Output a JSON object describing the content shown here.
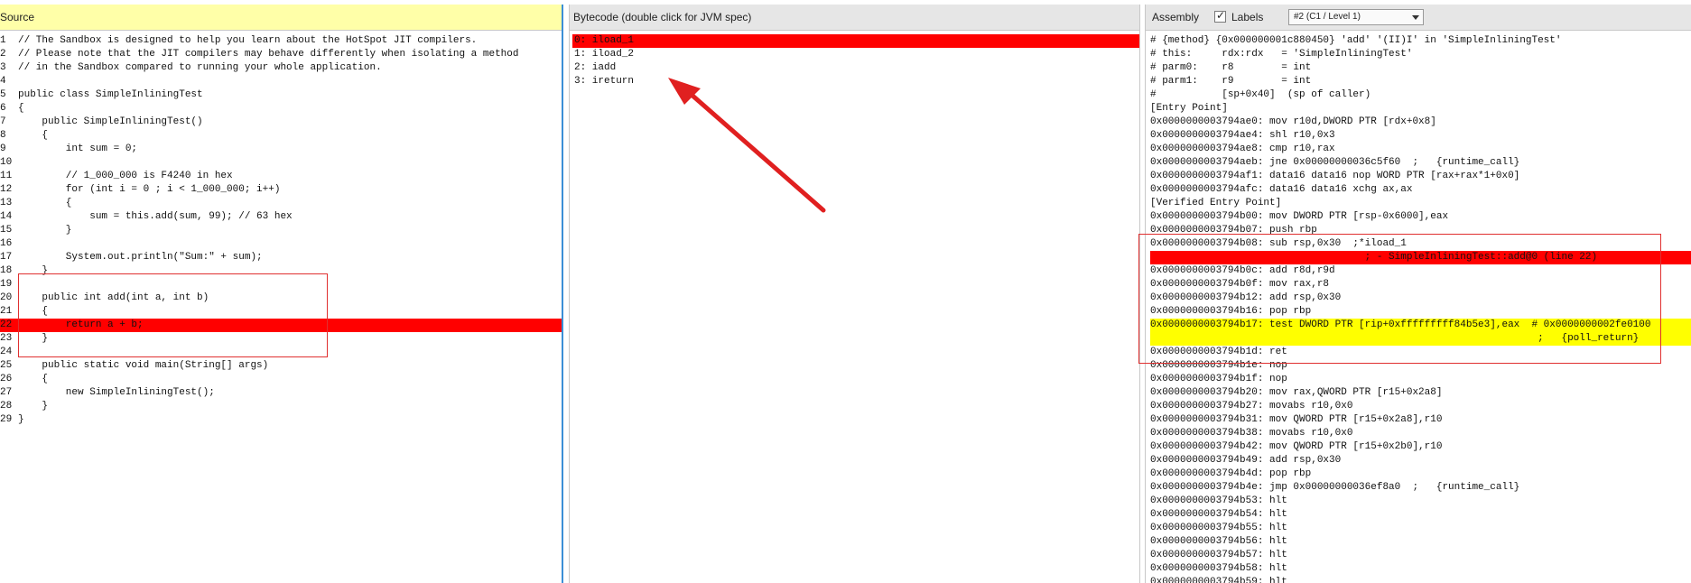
{
  "source": {
    "title": "Source",
    "lines": [
      {
        "n": "1",
        "text": "// The Sandbox is designed to help you learn about the HotSpot JIT compilers."
      },
      {
        "n": "2",
        "text": "// Please note that the JIT compilers may behave differently when isolating a method"
      },
      {
        "n": "3",
        "text": "// in the Sandbox compared to running your whole application."
      },
      {
        "n": "4",
        "text": ""
      },
      {
        "n": "5",
        "text": "public class SimpleInliningTest"
      },
      {
        "n": "6",
        "text": "{"
      },
      {
        "n": "7",
        "text": "    public SimpleInliningTest()"
      },
      {
        "n": "8",
        "text": "    {"
      },
      {
        "n": "9",
        "text": "        int sum = 0;"
      },
      {
        "n": "10",
        "text": ""
      },
      {
        "n": "11",
        "text": "        // 1_000_000 is F4240 in hex"
      },
      {
        "n": "12",
        "text": "        for (int i = 0 ; i < 1_000_000; i++)"
      },
      {
        "n": "13",
        "text": "        {"
      },
      {
        "n": "14",
        "text": "            sum = this.add(sum, 99); // 63 hex"
      },
      {
        "n": "15",
        "text": "        }"
      },
      {
        "n": "16",
        "text": ""
      },
      {
        "n": "17",
        "text": "        System.out.println(\"Sum:\" + sum);"
      },
      {
        "n": "18",
        "text": "    }"
      },
      {
        "n": "19",
        "text": ""
      },
      {
        "n": "20",
        "text": "    public int add(int a, int b)"
      },
      {
        "n": "21",
        "text": "    {"
      },
      {
        "n": "22",
        "text": "        return a + b;",
        "highlight": "red"
      },
      {
        "n": "23",
        "text": "    }"
      },
      {
        "n": "24",
        "text": ""
      },
      {
        "n": "25",
        "text": "    public static void main(String[] args)"
      },
      {
        "n": "26",
        "text": "    {"
      },
      {
        "n": "27",
        "text": "        new SimpleInliningTest();"
      },
      {
        "n": "28",
        "text": "    }"
      },
      {
        "n": "29",
        "text": "}"
      }
    ]
  },
  "bytecode": {
    "title": "Bytecode (double click for JVM spec)",
    "lines": [
      {
        "text": "0: iload_1",
        "highlight": "red"
      },
      {
        "text": "1: iload_2"
      },
      {
        "text": "2: iadd"
      },
      {
        "text": "3: ireturn"
      }
    ]
  },
  "assembly": {
    "title": "Assembly",
    "labels_checkbox": {
      "label": "Labels",
      "checked": true,
      "mark": "✓"
    },
    "tier_select": {
      "value": "#2  (C1 / Level 1)"
    },
    "lines": [
      {
        "text": "# {method} {0x000000001c880450} 'add' '(II)I' in 'SimpleInliningTest'"
      },
      {
        "text": "# this:     rdx:rdx   = 'SimpleInliningTest'"
      },
      {
        "text": "# parm0:    r8        = int"
      },
      {
        "text": "# parm1:    r9        = int"
      },
      {
        "text": "#           [sp+0x40]  (sp of caller)"
      },
      {
        "text": "[Entry Point]"
      },
      {
        "text": "0x0000000003794ae0: mov r10d,DWORD PTR [rdx+0x8]"
      },
      {
        "text": "0x0000000003794ae4: shl r10,0x3"
      },
      {
        "text": "0x0000000003794ae8: cmp r10,rax"
      },
      {
        "text": "0x0000000003794aeb: jne 0x00000000036c5f60  ;   {runtime_call}"
      },
      {
        "text": "0x0000000003794af1: data16 data16 nop WORD PTR [rax+rax*1+0x0]"
      },
      {
        "text": "0x0000000003794afc: data16 data16 xchg ax,ax"
      },
      {
        "text": "[Verified Entry Point]"
      },
      {
        "text": "0x0000000003794b00: mov DWORD PTR [rsp-0x6000],eax"
      },
      {
        "text": "0x0000000003794b07: push rbp"
      },
      {
        "text": "0x0000000003794b08: sub rsp,0x30  ;*iload_1"
      },
      {
        "text": "                                    ; - SimpleInliningTest::add@0 (line 22)",
        "highlight": "red"
      },
      {
        "text": "0x0000000003794b0c: add r8d,r9d"
      },
      {
        "text": "0x0000000003794b0f: mov rax,r8"
      },
      {
        "text": "0x0000000003794b12: add rsp,0x30"
      },
      {
        "text": "0x0000000003794b16: pop rbp"
      },
      {
        "text": "0x0000000003794b17: test DWORD PTR [rip+0xfffffffff84b5e3],eax  # 0x0000000002fe0100",
        "highlight": "yellow"
      },
      {
        "text": "                                                                 ;   {poll_return}",
        "highlight": "yellow"
      },
      {
        "text": "0x0000000003794b1d: ret"
      },
      {
        "text": "0x0000000003794b1e: nop"
      },
      {
        "text": "0x0000000003794b1f: nop"
      },
      {
        "text": "0x0000000003794b20: mov rax,QWORD PTR [r15+0x2a8]"
      },
      {
        "text": "0x0000000003794b27: movabs r10,0x0"
      },
      {
        "text": "0x0000000003794b31: mov QWORD PTR [r15+0x2a8],r10"
      },
      {
        "text": "0x0000000003794b38: movabs r10,0x0"
      },
      {
        "text": "0x0000000003794b42: mov QWORD PTR [r15+0x2b0],r10"
      },
      {
        "text": "0x0000000003794b49: add rsp,0x30"
      },
      {
        "text": "0x0000000003794b4d: pop rbp"
      },
      {
        "text": "0x0000000003794b4e: jmp 0x00000000036ef8a0  ;   {runtime_call}"
      },
      {
        "text": "0x0000000003794b53: hlt"
      },
      {
        "text": "0x0000000003794b54: hlt"
      },
      {
        "text": "0x0000000003794b55: hlt"
      },
      {
        "text": "0x0000000003794b56: hlt"
      },
      {
        "text": "0x0000000003794b57: hlt"
      },
      {
        "text": "0x0000000003794b58: hlt"
      },
      {
        "text": "0x0000000003794b59: hlt"
      }
    ]
  },
  "colors": {
    "highlight_red": "#ff0000",
    "highlight_yellow": "#ffff00",
    "annotation_red": "#e02020",
    "source_header_bg": "#ffffa8"
  },
  "annotations": {
    "arrow_icon": "red-arrow-icon"
  }
}
